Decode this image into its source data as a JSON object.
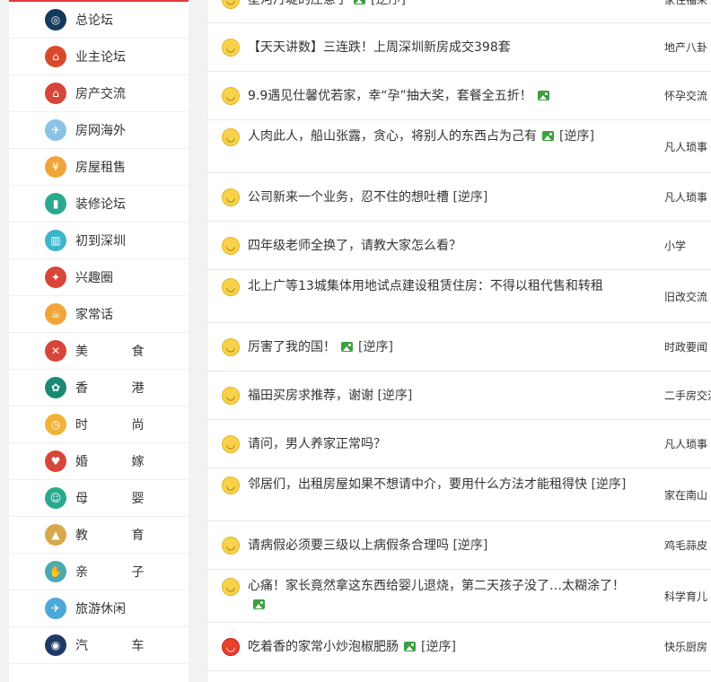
{
  "sidebar": {
    "items": [
      {
        "label": "总论坛",
        "icon": "globe-icon",
        "glyph": "◎",
        "color": "#123a5c",
        "spaced": false
      },
      {
        "label": "业主论坛",
        "icon": "house-icon",
        "glyph": "⌂",
        "color": "#d94a2b",
        "spaced": false
      },
      {
        "label": "房产交流",
        "icon": "home-icon",
        "glyph": "⌂",
        "color": "#d6453a",
        "spaced": false
      },
      {
        "label": "房网海外",
        "icon": "overseas-icon",
        "glyph": "✈",
        "color": "#8ac3e6",
        "spaced": false
      },
      {
        "label": "房屋租售",
        "icon": "rent-icon",
        "glyph": "¥",
        "color": "#f0a53a",
        "spaced": false
      },
      {
        "label": "装修论坛",
        "icon": "paint-roller-icon",
        "glyph": "▮",
        "color": "#2aa98f",
        "spaced": false
      },
      {
        "label": "初到深圳",
        "icon": "building-icon",
        "glyph": "▥",
        "color": "#3eb5c9",
        "spaced": false
      },
      {
        "label": "兴趣圈",
        "icon": "lightbulb-icon",
        "glyph": "✦",
        "color": "#d8463a",
        "spaced": false
      },
      {
        "label": "家常话",
        "icon": "teacup-icon",
        "glyph": "☕",
        "color": "#f0a53a",
        "spaced": false
      },
      {
        "label": "美 食",
        "icon": "fork-knife-icon",
        "glyph": "✕",
        "color": "#d8463a",
        "spaced": true
      },
      {
        "label": "香 港",
        "icon": "hongkong-icon",
        "glyph": "✿",
        "color": "#1a8a74",
        "spaced": true
      },
      {
        "label": "时 尚",
        "icon": "watch-icon",
        "glyph": "◷",
        "color": "#f2b23a",
        "spaced": true
      },
      {
        "label": "婚 嫁",
        "icon": "wedding-cup-icon",
        "glyph": "♥",
        "color": "#d8463a",
        "spaced": true
      },
      {
        "label": "母 婴",
        "icon": "baby-icon",
        "glyph": "☺",
        "color": "#2aa98f",
        "spaced": true
      },
      {
        "label": "教 育",
        "icon": "graduation-cap-icon",
        "glyph": "▲",
        "color": "#d9a84a",
        "spaced": true
      },
      {
        "label": "亲 子",
        "icon": "hand-icon",
        "glyph": "✋",
        "color": "#4aa9b5",
        "spaced": true
      },
      {
        "label": "旅游休闲",
        "icon": "airplane-icon",
        "glyph": "✈",
        "color": "#4aa9d8",
        "spaced": false
      },
      {
        "label": "汽 车",
        "icon": "steering-wheel-icon",
        "glyph": "◉",
        "color": "#1f3a66",
        "spaced": true
      }
    ]
  },
  "topics": [
    {
      "title": "星河丹堤的庄意了",
      "has_image": true,
      "reverse": "[逆序]",
      "forum": "家住福来",
      "mood": "smiley"
    },
    {
      "title": "【天天讲数】三连跌！上周深圳新房成交398套",
      "has_image": false,
      "reverse": "",
      "forum": "地产八卦",
      "mood": "smiley"
    },
    {
      "title": "9.9遇见仕馨优若家，幸“孕”抽大奖，套餐全五折！",
      "has_image": true,
      "reverse": "",
      "forum": "怀孕交流",
      "mood": "smiley"
    },
    {
      "title": "人肉此人，船山张露，贪心，将别人的东西占为己有",
      "has_image": true,
      "reverse": "[逆序]",
      "forum": "凡人琐事",
      "mood": "smiley"
    },
    {
      "title": "公司新来一个业务，忍不住的想吐槽",
      "has_image": false,
      "reverse": "[逆序]",
      "forum": "凡人琐事",
      "mood": "smiley"
    },
    {
      "title": "四年级老师全换了，请教大家怎么看？",
      "has_image": false,
      "reverse": "",
      "forum": "小学",
      "mood": "smiley"
    },
    {
      "title": "北上广等13城集体用地试点建设租赁住房：不得以租代售和转租",
      "has_image": false,
      "reverse": "",
      "forum": "旧改交流",
      "mood": "smiley"
    },
    {
      "title": "厉害了我的国！",
      "has_image": true,
      "reverse": "[逆序]",
      "forum": "时政要闻",
      "mood": "smiley"
    },
    {
      "title": "福田买房求推荐，谢谢",
      "has_image": false,
      "reverse": "[逆序]",
      "forum": "二手房交流",
      "mood": "smiley"
    },
    {
      "title": "请问，男人养家正常吗？",
      "has_image": false,
      "reverse": "",
      "forum": "凡人琐事",
      "mood": "smiley"
    },
    {
      "title": "邻居们，出租房屋如果不想请中介，要用什么方法才能租得快",
      "has_image": false,
      "reverse": "[逆序]",
      "forum": "家在南山",
      "mood": "smiley"
    },
    {
      "title": "请病假必须要三级以上病假条合理吗",
      "has_image": false,
      "reverse": "[逆序]",
      "forum": "鸡毛蒜皮",
      "mood": "smiley"
    },
    {
      "title": "心痛！家长竟然拿这东西给婴儿退烧，第二天孩子没了…太糊涂了！",
      "has_image": true,
      "reverse": "",
      "forum": "科学育儿",
      "mood": "smiley"
    },
    {
      "title": "吃着香的家常小炒泡椒肥肠",
      "has_image": true,
      "reverse": "[逆序]",
      "forum": "快乐厨房",
      "mood": "hot"
    }
  ]
}
